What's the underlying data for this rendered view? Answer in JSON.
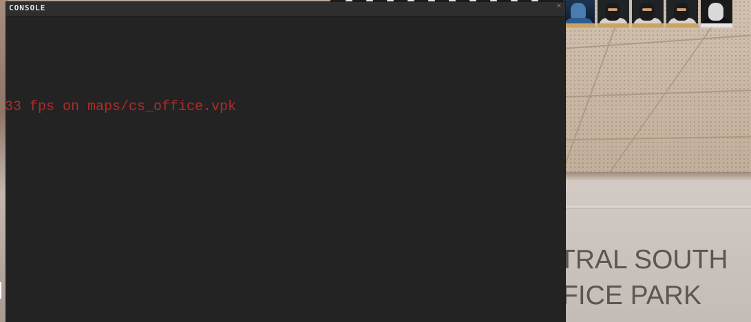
{
  "console": {
    "title": "CONSOLE",
    "close_label": "×",
    "lines": [
      "33 fps on maps/cs_office.vpk"
    ]
  },
  "scene": {
    "sign_line1": "TRAL SOUTH",
    "sign_line2": "FICE PARK"
  },
  "scoreboard": {
    "avatars": [
      {
        "team": "ct",
        "icon": "ct-player-avatar-icon"
      },
      {
        "team": "t",
        "icon": "masked-terrorist-avatar-icon"
      },
      {
        "team": "t",
        "icon": "masked-terrorist-avatar-icon"
      },
      {
        "team": "t",
        "icon": "masked-terrorist-avatar-icon"
      },
      {
        "team": "spectator",
        "icon": "pale-mask-avatar-icon"
      }
    ]
  },
  "colors": {
    "console_bg": "#232323",
    "console_text": "#b22a28",
    "avatar_border_gold": "#caa465"
  }
}
